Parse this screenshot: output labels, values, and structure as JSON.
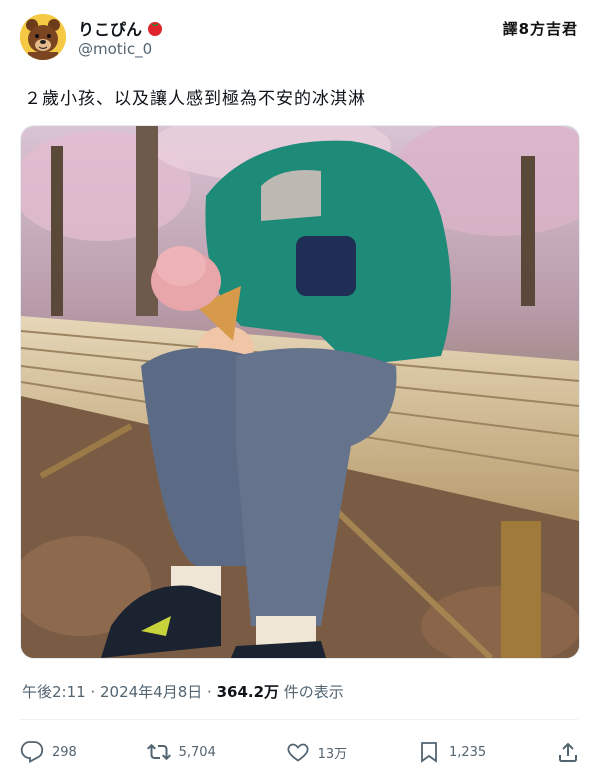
{
  "author": {
    "display_name": "りこぴん",
    "handle": "@motic_0",
    "name_emoji": "tomato-icon"
  },
  "watermark": "譯8方吉君",
  "tweet": {
    "text": "２歲小孩、以及讓人感到極為不安的冰淇淋"
  },
  "meta": {
    "time": "午後2:11",
    "sep1": " · ",
    "date": "2024年4月8日",
    "sep2": " · ",
    "views_count": "364.2万",
    "views_label": " 件の表示"
  },
  "actions": {
    "replies": "298",
    "reposts": "5,704",
    "likes": "13万",
    "bookmarks": "1,235"
  },
  "icons": {
    "reply": "reply-icon",
    "repost": "repost-icon",
    "like": "heart-icon",
    "bookmark": "bookmark-icon",
    "share": "share-icon"
  },
  "colors": {
    "secondary_text": "#536471",
    "primary_text": "#0f1419"
  }
}
